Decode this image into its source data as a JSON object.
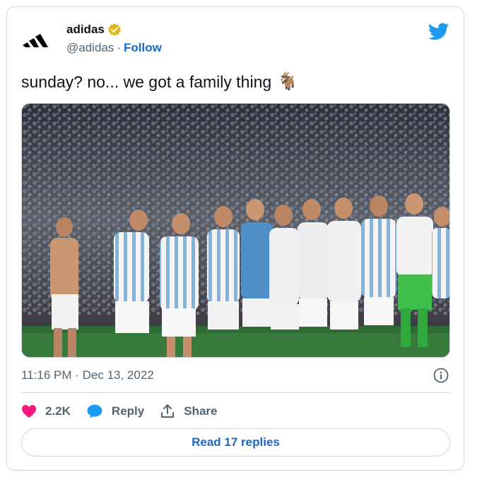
{
  "author": {
    "display_name": "adidas",
    "handle": "@adidas",
    "separator": "·",
    "follow_label": "Follow"
  },
  "tweet": {
    "text": "sunday? no... we got a family thing",
    "emoji": "🐐",
    "timestamp": "11:16 PM · Dec 13, 2022"
  },
  "actions": {
    "likes": "2.2K",
    "reply_label": "Reply",
    "share_label": "Share"
  },
  "read_replies_label": "Read 17 replies",
  "icons": {
    "logo": "adidas-logo-icon",
    "verified": "verified-badge-icon",
    "brand": "twitter-bird-icon",
    "info": "info-icon",
    "like": "heart-icon",
    "reply": "reply-bubble-icon",
    "share": "share-icon"
  },
  "colors": {
    "twitter_blue": "#1d9bf0",
    "link_blue": "#1d66c6",
    "heart_pink": "#f91880",
    "gold_badge": "#e2b719",
    "muted_text": "#536471",
    "border": "#cfd9de"
  }
}
